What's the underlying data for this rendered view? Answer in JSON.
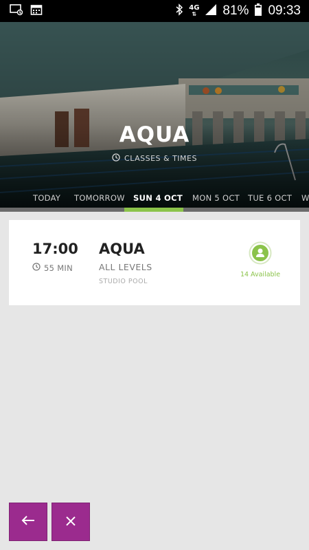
{
  "status_bar": {
    "network": "4G",
    "battery": "81%",
    "time": "09:33",
    "icons": [
      "screen-cast-icon",
      "calendar-icon",
      "bluetooth-icon",
      "signal-icon",
      "battery-icon"
    ]
  },
  "hero": {
    "title": "AQUA",
    "subtitle": "CLASSES & TIMES",
    "subtitle_icon": "clock-icon"
  },
  "tabs": [
    {
      "label": "TODAY"
    },
    {
      "label": "TOMORROW"
    },
    {
      "label": "SUN 4 OCT",
      "active": true
    },
    {
      "label": "MON 5 OCT"
    },
    {
      "label": "TUE 6 OCT"
    },
    {
      "label": "W"
    }
  ],
  "classes": [
    {
      "time": "17:00",
      "duration": "55 MIN",
      "name": "AQUA",
      "level": "ALL LEVELS",
      "location": "STUDIO POOL",
      "availability": "14 Available"
    }
  ],
  "actions": {
    "back_icon": "arrow-left-icon",
    "close_icon": "close-icon"
  },
  "colors": {
    "accent_green": "#8bc34a",
    "button_purple": "#9b2b8e",
    "background": "#e6e6e6"
  }
}
